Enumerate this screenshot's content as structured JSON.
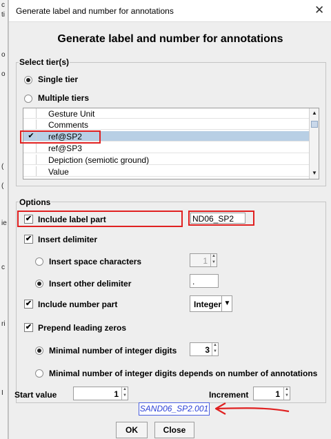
{
  "behind": {
    "edge_chars": [
      "c",
      "ti",
      "o",
      "o",
      "(",
      "(",
      "ie",
      "c",
      "ri",
      "I"
    ]
  },
  "window": {
    "title": "Generate label and number for annotations",
    "close_glyph": "✕"
  },
  "heading": "Generate label and number for annotations",
  "select_tiers": {
    "legend": "Select tier(s)",
    "single_tier": {
      "label": "Single tier",
      "selected": true
    },
    "multiple_tiers": {
      "label": "Multiple tiers",
      "selected": false
    },
    "tiers": [
      {
        "name": "Gesture Unit",
        "checked": false,
        "selected": false
      },
      {
        "name": "Comments",
        "checked": false,
        "selected": false
      },
      {
        "name": "ref@SP2",
        "checked": true,
        "selected": true
      },
      {
        "name": "ref@SP3",
        "checked": false,
        "selected": false
      },
      {
        "name": "Depiction (semiotic ground)",
        "checked": false,
        "selected": false
      },
      {
        "name": "Value",
        "checked": false,
        "selected": false
      }
    ]
  },
  "options": {
    "legend": "Options",
    "include_label_part": {
      "label": "Include label part",
      "checked": true,
      "value": "ND06_SP2"
    },
    "insert_delimiter": {
      "label": "Insert delimiter",
      "checked": true
    },
    "insert_space_characters": {
      "label": "Insert space characters",
      "selected": false,
      "value": "1"
    },
    "insert_other_delimiter": {
      "label": "Insert other delimiter",
      "selected": true,
      "value": "."
    },
    "include_number_part": {
      "label": "Include number part",
      "checked": true,
      "type_value": "Integer"
    },
    "prepend_leading_zeros": {
      "label": "Prepend leading zeros",
      "checked": true
    },
    "minimal_digits": {
      "label": "Minimal number of integer digits",
      "selected": true,
      "value": "3"
    },
    "minimal_digits_depends": {
      "label": "Minimal number of integer digits depends on number of annotations",
      "selected": false
    },
    "start_value": {
      "label": "Start value",
      "value": "1"
    },
    "increment": {
      "label": "Increment",
      "value": "1"
    },
    "preview": "SAND06_SP2.001"
  },
  "buttons": {
    "ok": "OK",
    "close": "Close"
  },
  "colors": {
    "highlight_red": "#e02020",
    "selection_blue": "#b8cfe5",
    "preview_text": "#2a3fd6"
  },
  "icons": {
    "checkmark": "✔",
    "spin_up": "▲",
    "spin_down": "▼",
    "dropdown": "▼"
  }
}
